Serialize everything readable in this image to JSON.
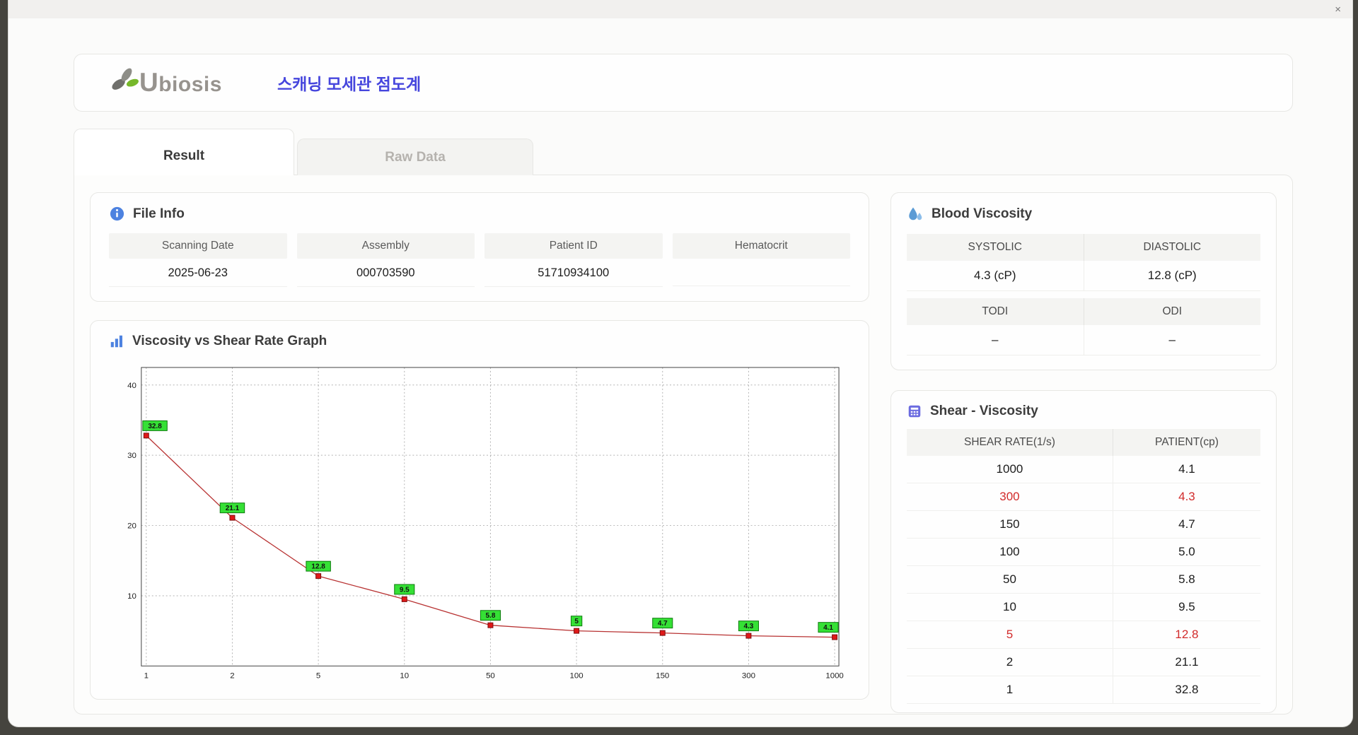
{
  "window": {
    "close_label": "×"
  },
  "header": {
    "brand": "Ubiosis",
    "title": "스캐닝 모세관 점도계"
  },
  "tabs": [
    {
      "label": "Result",
      "active": true
    },
    {
      "label": "Raw Data",
      "active": false
    }
  ],
  "file_info": {
    "title": "File Info",
    "fields": [
      {
        "label": "Scanning Date",
        "value": "2025-06-23"
      },
      {
        "label": "Assembly",
        "value": "000703590"
      },
      {
        "label": "Patient ID",
        "value": "51710934100"
      },
      {
        "label": "Hematocrit",
        "value": ""
      }
    ]
  },
  "blood_viscosity": {
    "title": "Blood Viscosity",
    "cells": [
      {
        "label": "SYSTOLIC",
        "value": "4.3 (cP)"
      },
      {
        "label": "DIASTOLIC",
        "value": "12.8 (cP)"
      },
      {
        "label": "TODI",
        "value": "–"
      },
      {
        "label": "ODI",
        "value": "–"
      }
    ]
  },
  "shear_viscosity": {
    "title": "Shear - Viscosity",
    "columns": [
      "SHEAR RATE(1/s)",
      "PATIENT(cp)"
    ],
    "rows": [
      {
        "rate": "1000",
        "patient": "4.1",
        "highlight": false
      },
      {
        "rate": "300",
        "patient": "4.3",
        "highlight": true
      },
      {
        "rate": "150",
        "patient": "4.7",
        "highlight": false
      },
      {
        "rate": "100",
        "patient": "5.0",
        "highlight": false
      },
      {
        "rate": "50",
        "patient": "5.8",
        "highlight": false
      },
      {
        "rate": "10",
        "patient": "9.5",
        "highlight": false
      },
      {
        "rate": "5",
        "patient": "12.8",
        "highlight": true
      },
      {
        "rate": "2",
        "patient": "21.1",
        "highlight": false
      },
      {
        "rate": "1",
        "patient": "32.8",
        "highlight": false
      }
    ]
  },
  "chart_data": {
    "type": "line",
    "title": "Viscosity vs Shear Rate Graph",
    "x": [
      1,
      2,
      5,
      10,
      50,
      100,
      150,
      300,
      1000
    ],
    "values": [
      32.8,
      21.1,
      12.8,
      9.5,
      5.8,
      5.0,
      4.7,
      4.3,
      4.1
    ],
    "point_labels": [
      "32.8",
      "21.1",
      "12.8",
      "9.5",
      "5.8",
      "5",
      "4.7",
      "4.3",
      "4.1"
    ],
    "xlabel": "",
    "ylabel": "",
    "x_axis": "categorical (log-style ticks)",
    "ylim": [
      0,
      42.5
    ],
    "yticks": [
      10,
      20,
      30,
      40
    ],
    "grid": "dotted",
    "legend": "none",
    "line_color": "#b83232",
    "marker_color": "#e01818",
    "point_label_bg": "#35e035"
  },
  "colors": {
    "accent_blue": "#4646dd",
    "icon_blue": "#4d82e0",
    "brand_green": "#76b82a",
    "highlight_red": "#d22b2b"
  }
}
